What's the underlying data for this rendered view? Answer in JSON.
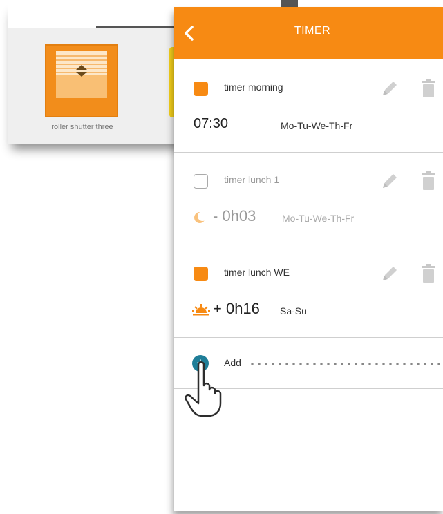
{
  "background": {
    "tile_label": "roller shutter three"
  },
  "timer": {
    "title": "TIMER",
    "accent_color": "#f78a13",
    "items": [
      {
        "name": "timer morning",
        "enabled": true,
        "time": "07:30",
        "days": "Mo-Tu-We-Th-Fr"
      },
      {
        "name": "timer lunch 1",
        "enabled": false,
        "offset_type": "moon-icon",
        "offset": "- 0h03",
        "days": "Mo-Tu-We-Th-Fr"
      },
      {
        "name": "timer lunch WE",
        "enabled": true,
        "offset_type": "sun-icon",
        "offset": "+ 0h16",
        "days": "Sa-Su"
      }
    ],
    "add_label": "Add",
    "add_symbol": "+"
  }
}
